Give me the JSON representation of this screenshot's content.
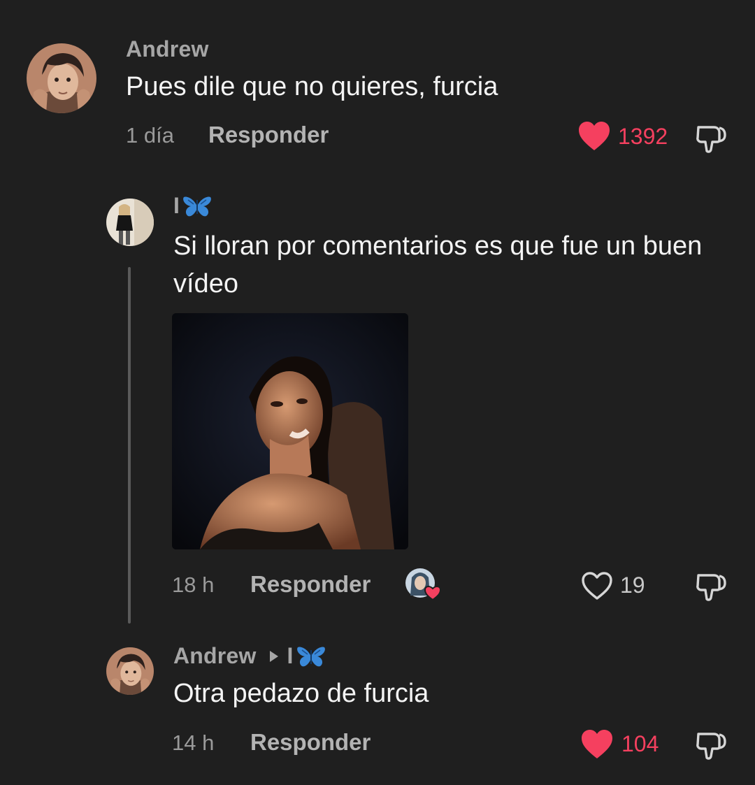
{
  "colors": {
    "background": "#1f1f1f",
    "like_active": "#f5405f",
    "text_primary": "#f4f4f4",
    "text_secondary": "#a6a6a6"
  },
  "comments": [
    {
      "username": "Andrew",
      "text": "Pues dile que no quieres, furcia",
      "time": "1 día",
      "reply_label": "Responder",
      "like_count": "1392",
      "liked": true,
      "avatar_icon": "anime-character-avatar"
    },
    {
      "username": "I",
      "username_emoji": "butterfly-icon",
      "text": "Si lloran por comentarios es que fue un buen vídeo",
      "time": "18 h",
      "reply_label": "Responder",
      "like_count": "19",
      "liked": false,
      "has_image": true,
      "avatar_icon": "person-photo-avatar",
      "liked_by_creator": true
    },
    {
      "username": "Andrew",
      "reply_to": "I",
      "text": "Otra pedazo de furcia",
      "time": "14 h",
      "reply_label": "Responder",
      "like_count": "104",
      "liked": true,
      "avatar_icon": "anime-character-avatar"
    }
  ]
}
